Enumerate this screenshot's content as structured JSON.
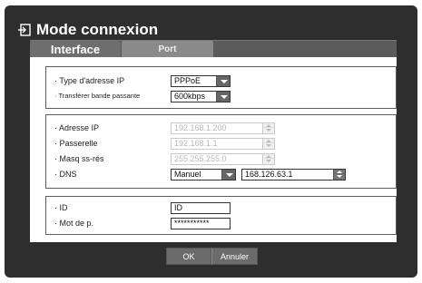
{
  "title": "Mode connexion",
  "icon": "connection-icon",
  "tabs": [
    {
      "label": "Interface",
      "active": true
    },
    {
      "label": "Port",
      "active": false
    }
  ],
  "connection": {
    "ip_type_label": "· Type d'adresse IP",
    "ip_type_value": "PPPoE",
    "bandwidth_label": "· Transférer bande passante",
    "bandwidth_value": "600kbps"
  },
  "network": {
    "ip_label": "· Adresse IP",
    "ip_value": "192.168.1.200",
    "gateway_label": "· Passerelle",
    "gateway_value": "192.168.1.1",
    "mask_label": "· Masq ss-rés",
    "mask_value": "255.255.255.0",
    "dns_label": "· DNS",
    "dns_mode": "Manuel",
    "dns_value": "168.126.63.1"
  },
  "account": {
    "id_label": "· ID",
    "id_value": "ID",
    "password_label": "· Mot de p.",
    "password_value": "***********"
  },
  "buttons": {
    "ok": "OK",
    "cancel": "Annuler"
  },
  "colors": {
    "background": "#2e2e2e",
    "tabbar": "#5b5b5b",
    "dropdown_arrow": "#666666",
    "disabled_text": "#b8b8b8"
  }
}
